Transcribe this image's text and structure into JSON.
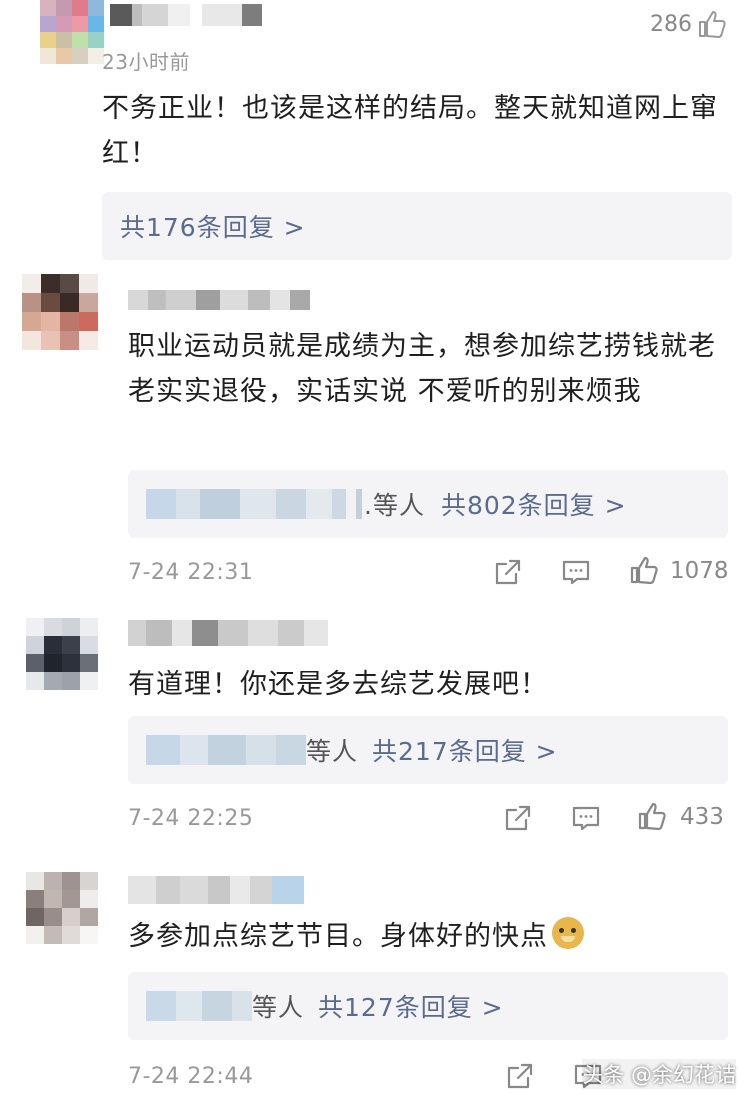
{
  "comments": [
    {
      "time": "23小时前",
      "likes": "286",
      "text": "不务正业！也该是这样的结局。整天就知道网上窜红！",
      "replies": "共176条回复 >",
      "reply_prefix": ""
    },
    {
      "time": "7-24 22:31",
      "likes": "1078",
      "text": "职业运动员就是成绩为主，想参加综艺捞钱就老老实实退役，实话实说 不爱听的别来烦我",
      "reply_prefix": ".等人",
      "replies": "共802条回复 >"
    },
    {
      "time": "7-24 22:25",
      "likes": "433",
      "text": "有道理！你还是多去综艺发展吧！",
      "reply_prefix": "等人",
      "replies": "共217条回复 >"
    },
    {
      "time": "7-24 22:44",
      "likes": "",
      "text": "多参加点综艺节目。身体好的快点",
      "reply_prefix": "等人",
      "replies": "共127条回复 >"
    }
  ],
  "watermark": "头条 @余幻花诘",
  "icons": {
    "share": "share-icon",
    "comment": "comment-icon",
    "like": "thumbs-up-icon",
    "emoji": "doge-emoji-icon"
  },
  "colors": {
    "reply_link": "#5b6b8c",
    "reply_bg": "#f4f4f6",
    "time": "#999999"
  }
}
